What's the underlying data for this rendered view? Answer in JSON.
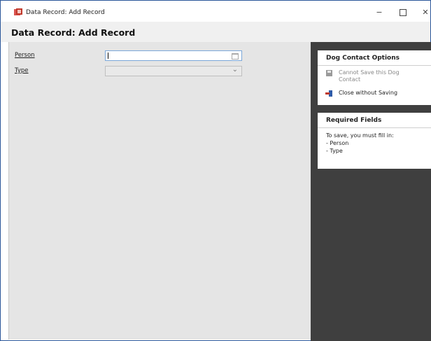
{
  "window": {
    "title": "Data Record: Add Record",
    "minimize_glyph": "−",
    "close_glyph": "✕"
  },
  "header": {
    "title": "Data Record: Add Record"
  },
  "form": {
    "person": {
      "label": "Person",
      "value": "",
      "icon": "folder-icon"
    },
    "type": {
      "label": "Type",
      "value": "",
      "icon": "chevron-down-icon"
    }
  },
  "options": {
    "title": "Dog Contact Options",
    "save_label": "Cannot Save this Dog Contact",
    "close_label": "Close without Saving"
  },
  "required": {
    "title": "Required Fields",
    "intro": "To save, you must fill in:",
    "items": [
      "- Person",
      "- Type"
    ]
  },
  "colors": {
    "window_border": "#2b579a",
    "form_background": "#e5e5e5",
    "side_panel": "#3f3f3f",
    "focus_border": "#7aa7d9"
  }
}
